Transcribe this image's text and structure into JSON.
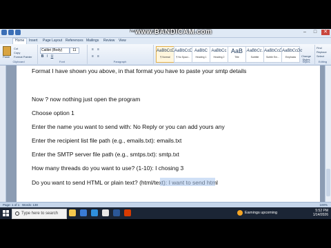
{
  "window": {
    "title": "New Microsoft Office Word",
    "watermark": "www.BANDICAM.com"
  },
  "ribbon": {
    "tabs": [
      "Home",
      "Insert",
      "Page Layout",
      "References",
      "Mailings",
      "Review",
      "View"
    ],
    "clipboard": {
      "paste": "Paste",
      "cut": "Cut",
      "copy": "Copy",
      "format_painter": "Format Painter",
      "label": "Clipboard"
    },
    "font": {
      "name": "Calibri (Body)",
      "size": "11",
      "label": "Font"
    },
    "paragraph_label": "Paragraph",
    "styles": [
      {
        "sample": "AaBbCcDc",
        "name": "¶ Normal"
      },
      {
        "sample": "AaBbCcDc",
        "name": "¶ No Spaci..."
      },
      {
        "sample": "AaBbC",
        "name": "Heading 1"
      },
      {
        "sample": "AaBbCc",
        "name": "Heading 2"
      },
      {
        "sample": "AaB",
        "name": "Title"
      },
      {
        "sample": "AaBbCc.",
        "name": "Subtitle"
      },
      {
        "sample": "AaBbCcDc",
        "name": "Subtle Em..."
      },
      {
        "sample": "AaBbCcDc",
        "name": "Emphasis"
      }
    ],
    "change_styles": "Change Styles",
    "styles_label": "Styles",
    "editing": {
      "find": "Find",
      "replace": "Replace",
      "select": "Select",
      "label": "Editing"
    }
  },
  "document": {
    "lines": [
      "Format I have shown you above, in that format you have to paste your smtp details",
      "Now ? now nothing just open the program",
      "Choose option 1",
      "Enter the name you want to send with: No Reply or you can add yours any",
      "Enter the recipient list file path (e.g., emails.txt): emails.txt",
      "Enter the SMTP server file path (e.g., smtps.txt): smtp.txt",
      "How many threads do you want to use? (1-10): I chosing 3",
      "Do you want to send HTML or plain text? (html/text): I want to send html"
    ]
  },
  "statusbar": {
    "page": "Page: 1 of 1",
    "words": "Words: 138",
    "zoom": "100%"
  },
  "taskbar": {
    "search_placeholder": "Type here to search",
    "weather": "Earnings upcoming",
    "time": "5:52 PM",
    "date": "1/14/2026"
  },
  "colors": {
    "selection": "#a9c7ef",
    "ribbon": "#dce6f4",
    "taskbar": "#1b2535"
  }
}
